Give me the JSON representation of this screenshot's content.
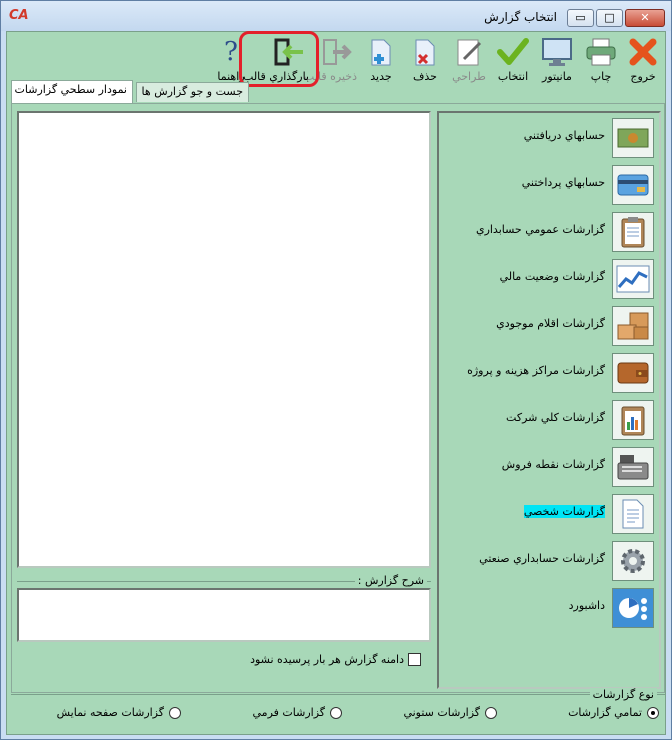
{
  "window": {
    "title": "انتخاب گزارش",
    "logo": "CA",
    "min": "▭",
    "max": "□",
    "close": "✕"
  },
  "toolbar": {
    "items": [
      {
        "label": "خروج",
        "icon": "exit-icon",
        "enabled": true
      },
      {
        "label": "چاپ",
        "icon": "printer-icon",
        "enabled": true
      },
      {
        "label": "مانيتور",
        "icon": "monitor-icon",
        "enabled": true
      },
      {
        "label": "انتخاب",
        "icon": "checkmark-icon",
        "enabled": true
      },
      {
        "label": "طراحي",
        "icon": "design-icon",
        "enabled": false
      },
      {
        "label": "حذف",
        "icon": "delete-page-icon",
        "enabled": true
      },
      {
        "label": "جديد",
        "icon": "new-page-icon",
        "enabled": true
      },
      {
        "label": "ذخيره قالب",
        "icon": "save-template-icon",
        "enabled": false
      },
      {
        "label": "بارگذاري قالب",
        "icon": "load-template-icon",
        "enabled": true
      },
      {
        "label": "راهنما",
        "icon": "help-icon",
        "enabled": true
      }
    ],
    "help_glyph": "?"
  },
  "tabs": [
    {
      "label": "نمودار سطحي گزارشات",
      "active": true
    },
    {
      "label": "جست و جو گزارش ها",
      "active": false
    }
  ],
  "categories": [
    {
      "label": "حسابهاي دريافتني",
      "icon": "receivables-icon"
    },
    {
      "label": "حسابهاي پرداختني",
      "icon": "payables-icon"
    },
    {
      "label": "گزارشات عمومي حسابداري",
      "icon": "clipboard-icon"
    },
    {
      "label": "گزارشات وضعيت مالي",
      "icon": "line-chart-icon"
    },
    {
      "label": "گزارشات اقلام موجودي",
      "icon": "boxes-icon"
    },
    {
      "label": "گزارشات مراكز هزينه و پروژه",
      "icon": "wallet-icon"
    },
    {
      "label": "گزارشات كلي شركت",
      "icon": "bar-chart-icon"
    },
    {
      "label": "گزارشات نقطه فروش",
      "icon": "cash-register-icon"
    },
    {
      "label": "گزارشات شخصي",
      "icon": "document-icon",
      "selected": true
    },
    {
      "label": "گزارشات حسابداري صنعتي",
      "icon": "gear-icon"
    },
    {
      "label": "داشبورد",
      "icon": "dashboard-icon"
    }
  ],
  "description": {
    "label": "شرح گزارش :",
    "value": ""
  },
  "checkbox": {
    "label": "دامنه گزارش هر بار پرسيده نشود",
    "checked": false
  },
  "report_type": {
    "title": "نوع گزارشات",
    "options": [
      {
        "label": "تمامي گزارشات",
        "checked": true
      },
      {
        "label": "گزارشات ستوني",
        "checked": false
      },
      {
        "label": "گزارشات فرمي",
        "checked": false
      },
      {
        "label": "گزارشات صفحه نمايش",
        "checked": false
      }
    ]
  }
}
